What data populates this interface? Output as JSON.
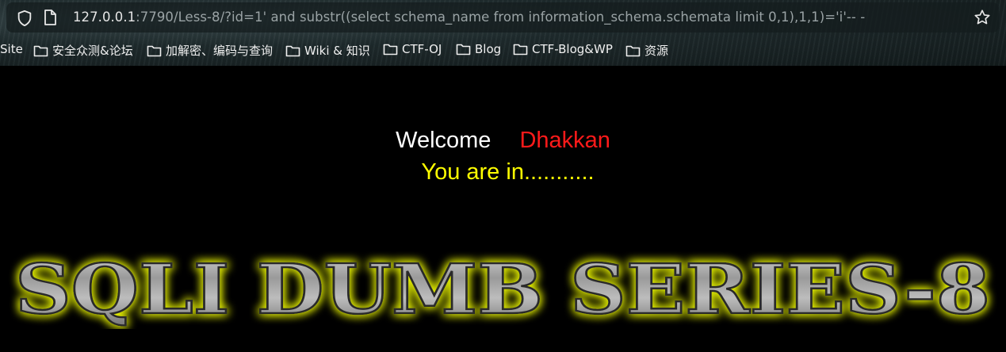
{
  "browser": {
    "url_host": "127.0.0.1",
    "url_rest": ":7790/Less-8/?id=1' and substr((select schema_name from information_schema.schemata limit 0,1),1,1)='i'-- -",
    "icons": [
      "shield-icon",
      "page-icon",
      "star-icon",
      "folder-icon"
    ]
  },
  "bookmarks": [
    {
      "label": "Site"
    },
    {
      "label": "安全众测&论坛"
    },
    {
      "label": "加解密、编码与查询"
    },
    {
      "label": "Wiki & 知识"
    },
    {
      "label": "CTF-OJ"
    },
    {
      "label": "Blog"
    },
    {
      "label": "CTF-Blog&WP"
    },
    {
      "label": "资源"
    }
  ],
  "page": {
    "welcome": "Welcome",
    "name": "Dhakkan",
    "status": "You are in...........",
    "banner": "SQLI DUMB SERIES-8",
    "colors": {
      "welcome": "#ffffff",
      "name": "#ff1a1a",
      "status": "#ffff00",
      "banner_glow": "#e5f000"
    }
  }
}
